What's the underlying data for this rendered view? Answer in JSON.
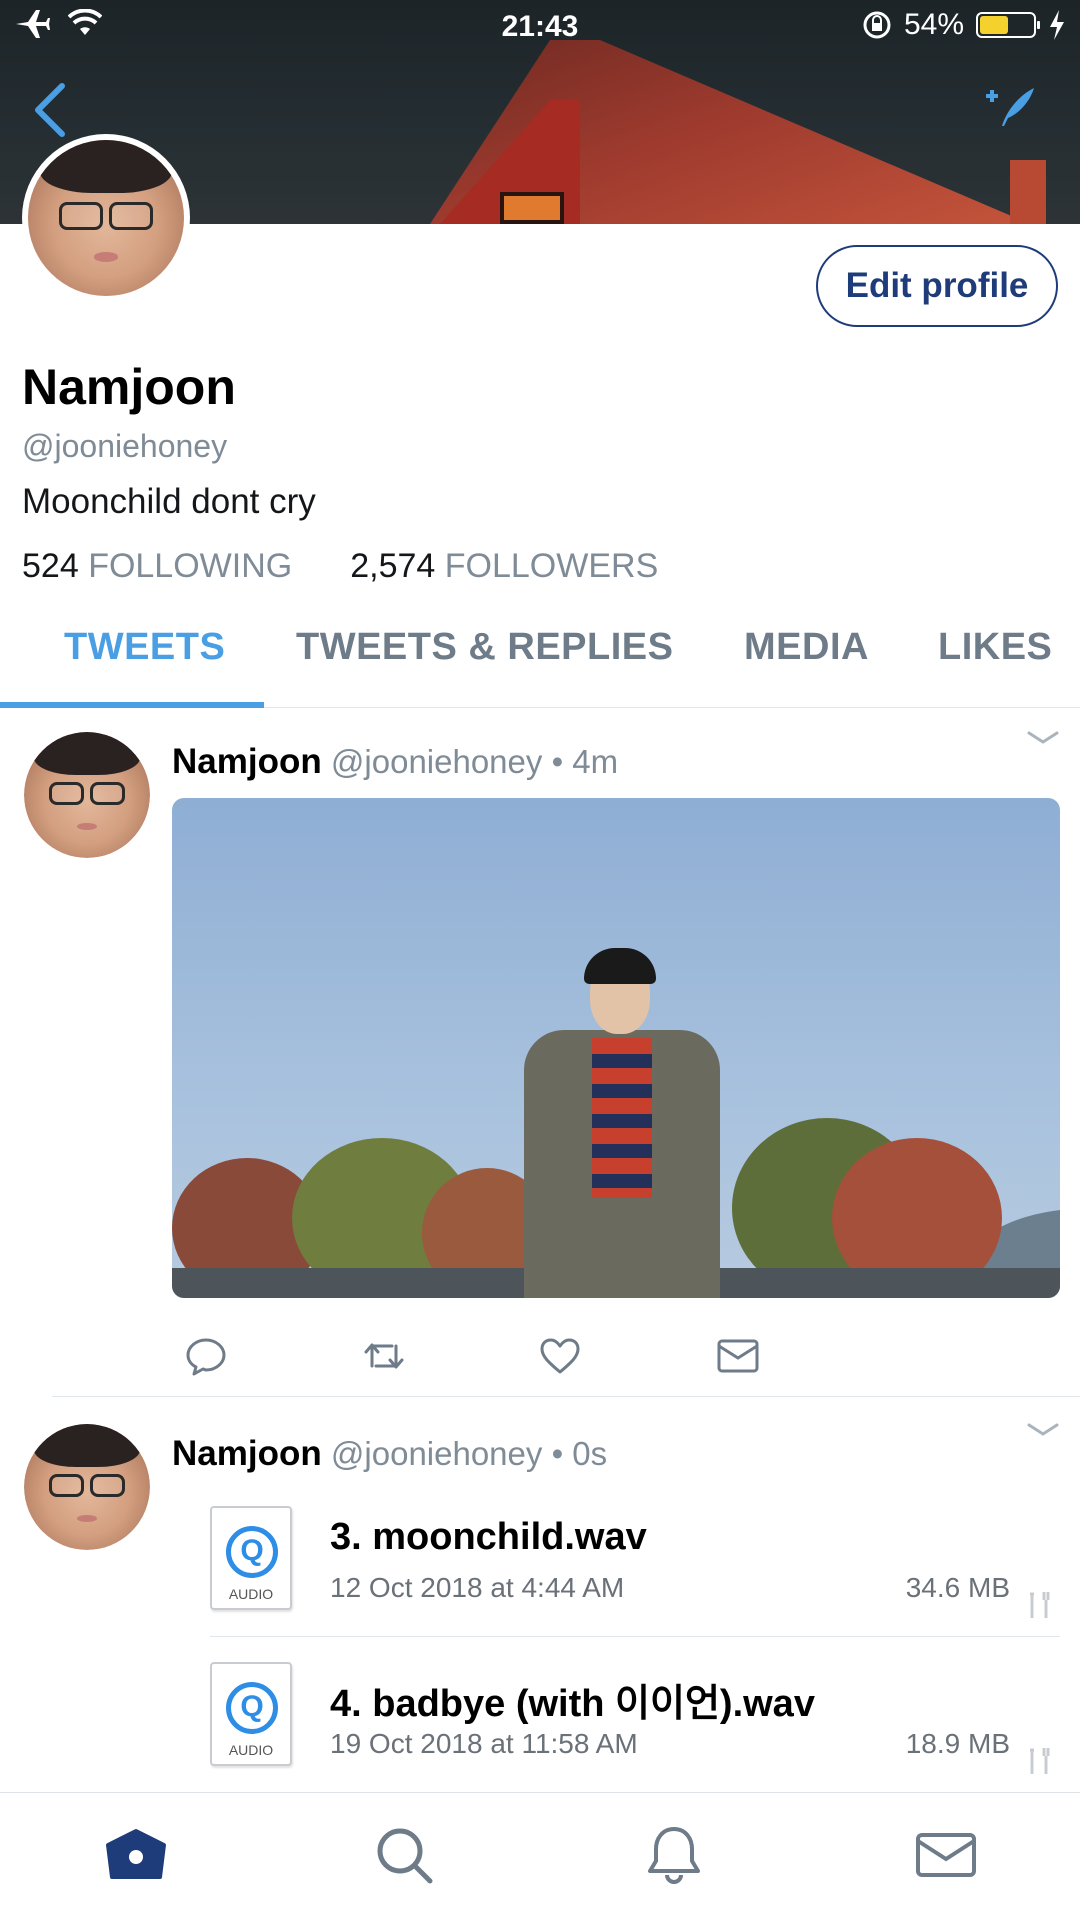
{
  "status_bar": {
    "time": "21:43",
    "battery": "54%",
    "battery_level": 0.54,
    "icons": [
      "airplane-icon",
      "wifi-icon",
      "rotation-lock-icon",
      "battery-icon",
      "charging-icon"
    ]
  },
  "header": {
    "back_icon": "chevron-left-icon",
    "compose_icon": "compose-tweet-icon",
    "edit_profile_label": "Edit profile"
  },
  "profile": {
    "name": "Namjoon",
    "handle": "@jooniehoney",
    "bio": "Moonchild dont cry",
    "following_count": "524",
    "following_label": "FOLLOWING",
    "followers_count": "2,574",
    "followers_label": "FOLLOWERS"
  },
  "tabs": [
    {
      "label": "TWEETS",
      "active": true
    },
    {
      "label": "TWEETS & REPLIES",
      "active": false
    },
    {
      "label": "MEDIA",
      "active": false
    },
    {
      "label": "LIKES",
      "active": false
    }
  ],
  "tweets": [
    {
      "name": "Namjoon",
      "handle": "@jooniehoney",
      "time": "• 4m",
      "media": "photo"
    },
    {
      "name": "Namjoon",
      "handle": "@jooniehoney",
      "time": "• 0s",
      "files": [
        {
          "icon_label": "AUDIO",
          "name": "3. moonchild.wav",
          "date": "12 Oct 2018 at 4:44 AM",
          "size": "34.6 MB"
        },
        {
          "icon_label": "AUDIO",
          "name": "4. badbye (with 이이언).wav",
          "date": "19 Oct 2018 at 11:58 AM",
          "size": "18.9 MB"
        }
      ]
    }
  ],
  "tweet_actions": [
    "reply-icon",
    "retweet-icon",
    "like-icon",
    "direct-message-icon"
  ],
  "bottom_nav": [
    "home-icon",
    "search-icon",
    "notifications-icon",
    "messages-icon"
  ],
  "colors": {
    "accent": "#4a9ee3",
    "edit_button": "#1f3c7a",
    "muted_text": "#7f8b96",
    "battery_fill": "#f5d12e"
  }
}
